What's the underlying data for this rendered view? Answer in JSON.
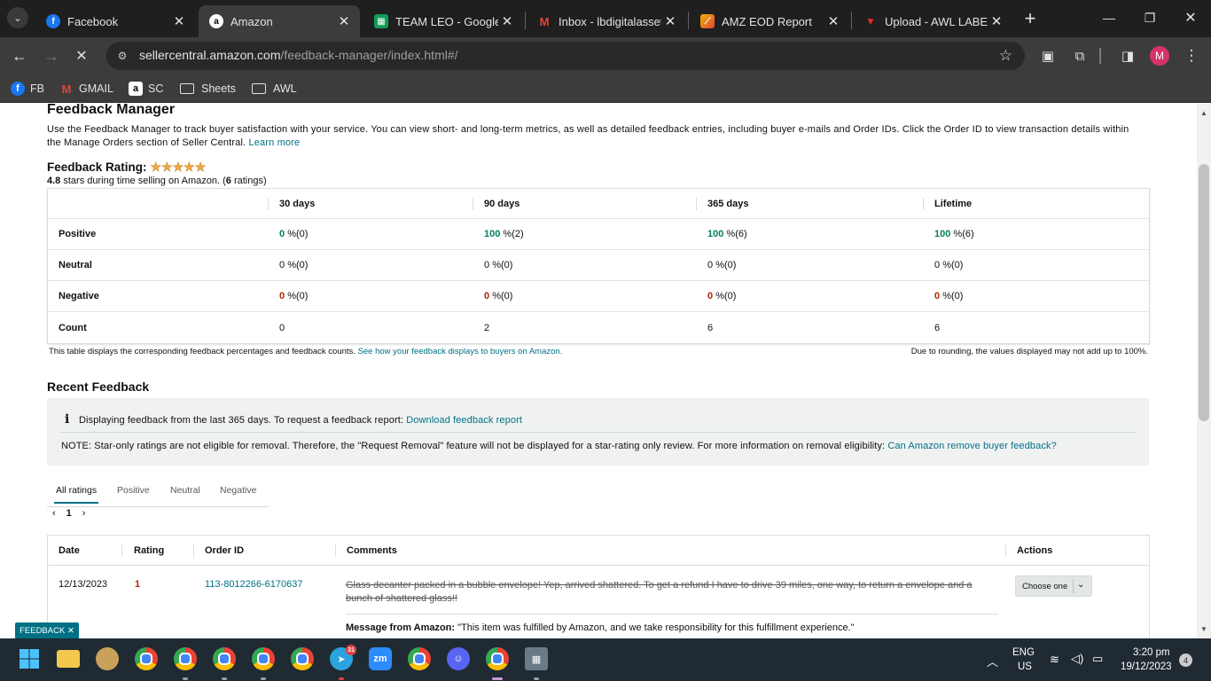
{
  "browser": {
    "tabs": [
      {
        "title": "Facebook",
        "icon": "facebook-icon",
        "color": "#1877f2"
      },
      {
        "title": "Amazon",
        "icon": "amazon-icon",
        "color": "#ffffff"
      },
      {
        "title": "TEAM LEO - Google S",
        "icon": "google-sheets-icon",
        "color": "#0f9d58"
      },
      {
        "title": "Inbox - lbdigitalasset",
        "icon": "gmail-icon",
        "color": "#ea4335"
      },
      {
        "title": "AMZ EOD Report",
        "icon": "report-icon",
        "color": "#f4b400"
      },
      {
        "title": "Upload - AWL LABEL",
        "icon": "awl-icon",
        "color": "#d93025"
      }
    ],
    "url_host": "sellercentral.amazon.com",
    "url_path": "/feedback-manager/index.html#/",
    "avatar_letter": "M",
    "bookmarks": [
      {
        "label": "FB",
        "icon": "facebook-icon"
      },
      {
        "label": "GMAIL",
        "icon": "gmail-icon"
      },
      {
        "label": "SC",
        "icon": "amazon-icon"
      },
      {
        "label": "Sheets",
        "icon": "folder-icon"
      },
      {
        "label": "AWL",
        "icon": "folder-icon"
      }
    ]
  },
  "page": {
    "title": "Feedback Manager",
    "intro": "Use the Feedback Manager to track buyer satisfaction with your service. You can view short- and long-term metrics, as well as detailed feedback entries, including buyer e-mails and Order IDs. Click the Order ID to view transaction details within the Manage Orders section of Seller Central.",
    "learn_more": "Learn more",
    "rating_label": "Feedback Rating:",
    "stars": "★★★★★",
    "rating_value": "4.8",
    "rating_text": "stars during time selling on Amazon. (",
    "rating_count": "6",
    "rating_suffix": "ratings)",
    "table": {
      "headers": [
        "30 days",
        "90 days",
        "365 days",
        "Lifetime"
      ],
      "rows": [
        {
          "label": "Positive",
          "cells": [
            {
              "v": "0",
              "u": "%(0)"
            },
            {
              "v": "100",
              "u": "%(2)"
            },
            {
              "v": "100",
              "u": "%(6)"
            },
            {
              "v": "100",
              "u": "%(6)"
            }
          ]
        },
        {
          "label": "Neutral",
          "cells": [
            {
              "v": "0",
              "u": "%(0)"
            },
            {
              "v": "0",
              "u": "%(0)"
            },
            {
              "v": "0",
              "u": "%(0)"
            },
            {
              "v": "0",
              "u": "%(0)"
            }
          ]
        },
        {
          "label": "Negative",
          "cells": [
            {
              "v": "0",
              "u": "%(0)"
            },
            {
              "v": "0",
              "u": "%(0)"
            },
            {
              "v": "0",
              "u": "%(0)"
            },
            {
              "v": "0",
              "u": "%(0)"
            }
          ]
        },
        {
          "label": "Count",
          "cells": [
            {
              "v": "0",
              "u": ""
            },
            {
              "v": "2",
              "u": ""
            },
            {
              "v": "6",
              "u": ""
            },
            {
              "v": "6",
              "u": ""
            }
          ]
        }
      ]
    },
    "note_left": "This table displays the corresponding feedback percentages and feedback counts.",
    "note_left_link": "See how your feedback displays to buyers on Amazon.",
    "note_right": "Due to rounding, the values displayed may not add up to 100%.",
    "recent_title": "Recent Feedback",
    "info_text": "Displaying feedback from the last 365 days. To request a feedback report:",
    "info_link": "Download feedback report",
    "note_text": "NOTE: Star-only ratings are not eligible for removal. Therefore, the \"Request Removal\" feature will not be displayed for a star-rating only review. For more information on removal eligibility:",
    "note_link": "Can Amazon remove buyer feedback?",
    "filter_tabs": [
      "All ratings",
      "Positive",
      "Neutral",
      "Negative"
    ],
    "page_number": "1",
    "feedback_headers": [
      "Date",
      "Rating",
      "Order ID",
      "Comments",
      "Actions"
    ],
    "feedback_rows": [
      {
        "date": "12/13/2023",
        "rating": "1",
        "order_id": "113-8012266-6170637",
        "comment": "Glass decanter packed in a bubble envelope! Yep, arrived shattered. To get a refund I have to drive 39 miles, one way, to return a envelope and a bunch of shattered glass!!",
        "message_label": "Message from Amazon:",
        "message": "\"This item was fulfilled by Amazon, and we take responsibility for this fulfillment experience.\"",
        "action": "Choose one"
      }
    ],
    "feedback_pill": "FEEDBACK ✕"
  },
  "taskbar": {
    "lang": "ENG",
    "region": "US",
    "time": "3:20 pm",
    "date": "19/12/2023",
    "notifications": "4",
    "telegram_badge": "31"
  }
}
